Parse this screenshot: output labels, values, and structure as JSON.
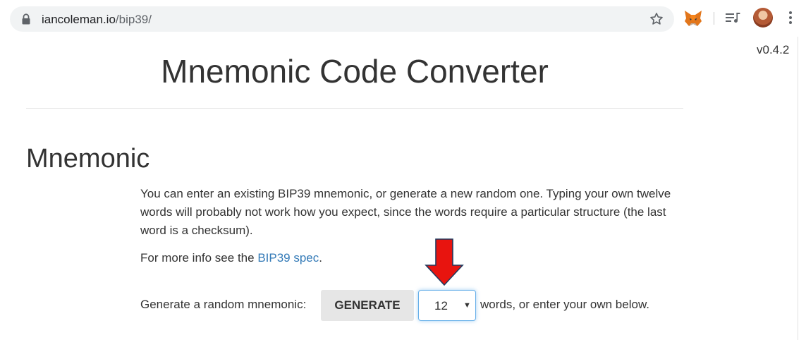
{
  "browser": {
    "url_host": "iancoleman.io",
    "url_path": "/bip39/",
    "icons": {
      "lock": "lock-icon",
      "bookmark": "star-icon",
      "extension": "metamask-fox-icon",
      "media": "media-control-icon",
      "profile": "avatar",
      "menu": "kebab-menu-icon"
    }
  },
  "page": {
    "version": "v0.4.2",
    "title": "Mnemonic Code Converter",
    "section_heading": "Mnemonic",
    "intro": "You can enter an existing BIP39 mnemonic, or generate a new random one. Typing your own twelve words will probably not work how you expect, since the words require a particular structure (the last word is a checksum).",
    "more_info_prefix": "For more info see the ",
    "more_info_link": "BIP39 spec",
    "more_info_suffix": ".",
    "generate_label": "Generate a random mnemonic:",
    "generate_button": "GENERATE",
    "word_count": "12",
    "generate_suffix": "words, or enter your own below."
  },
  "colors": {
    "link": "#337ab7",
    "button_bg": "#e6e6e6",
    "select_focus": "#66afe9",
    "annotation_arrow": "#e8140f"
  }
}
